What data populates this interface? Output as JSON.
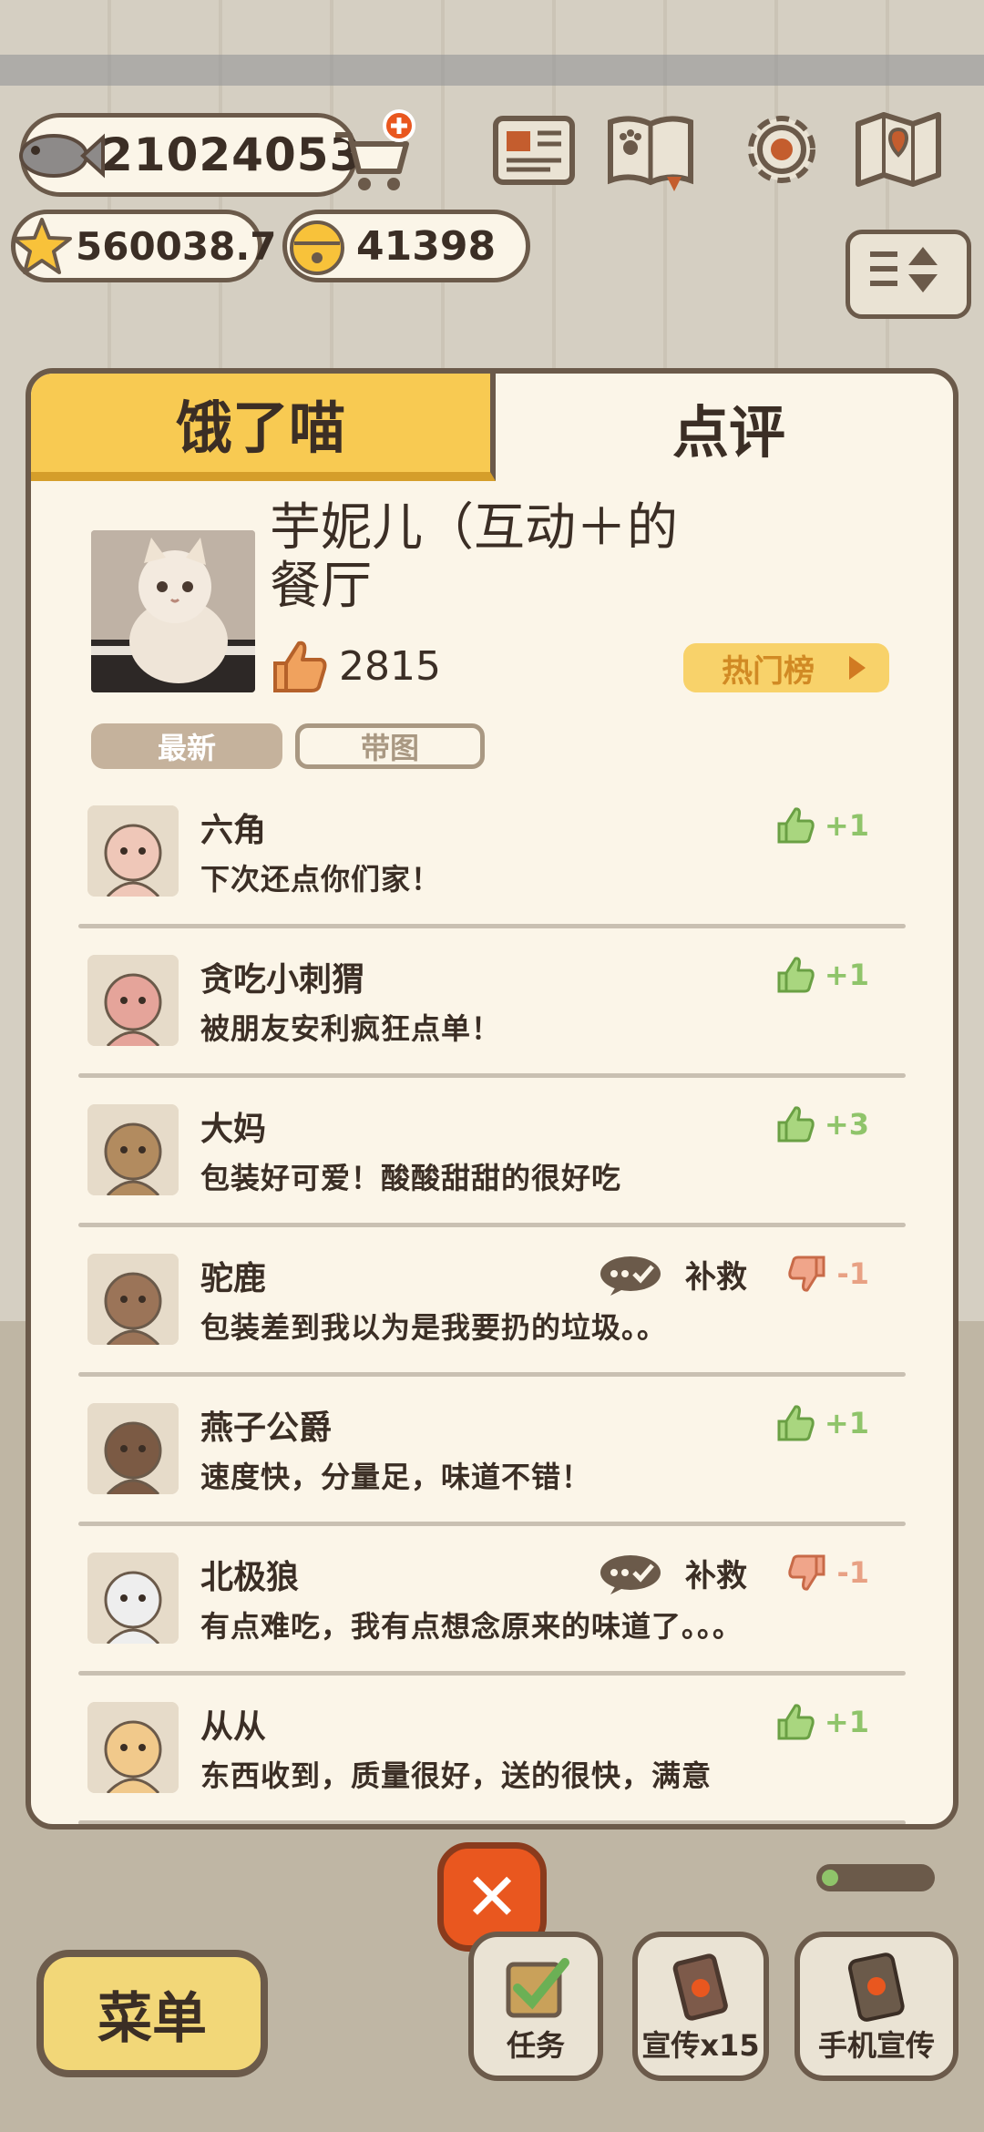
{
  "hud": {
    "fish_value": "21024053",
    "star_value": "560038.7",
    "bell_value": "41398",
    "icons": [
      "fish-icon",
      "shopping-cart-icon",
      "plus-icon",
      "star-icon",
      "bell-icon",
      "newspaper-icon",
      "paw-book-icon",
      "gear-icon",
      "map-icon",
      "sort-icon"
    ]
  },
  "dialog": {
    "tabs": [
      "饿了喵",
      "点评"
    ],
    "active_tab": "点评",
    "shop_name": "芋妮儿（互动＋的餐厅",
    "likes": "2815",
    "hot_list_label": "热门榜",
    "filters": [
      "最新",
      "带图"
    ],
    "active_filter": "最新",
    "reviews": [
      {
        "name": "六角",
        "text": "下次还点你们家！",
        "vote": "+1",
        "type": "up"
      },
      {
        "name": "贪吃小刺猬",
        "text": "被朋友安利疯狂点单！",
        "vote": "+1",
        "type": "up"
      },
      {
        "name": "大妈",
        "text": "包装好可爱！酸酸甜甜的很好吃",
        "vote": "+3",
        "type": "up"
      },
      {
        "name": "驼鹿",
        "text": "包装差到我以为是我要扔的垃圾。。",
        "vote": "-1",
        "type": "down",
        "remedy": "补救"
      },
      {
        "name": "燕子公爵",
        "text": "速度快，分量足，味道不错！",
        "vote": "+1",
        "type": "up"
      },
      {
        "name": "北极狼",
        "text": "有点难吃，我有点想念原来的味道了。。。",
        "vote": "-1",
        "type": "down",
        "remedy": "补救"
      },
      {
        "name": "从从",
        "text": "东西收到，质量很好，送的很快，满意",
        "vote": "+1",
        "type": "up"
      }
    ]
  },
  "bottom": {
    "close_label": "✕",
    "menu_label": "菜单",
    "task_label": "任务",
    "promo_label": "宣传x15",
    "phone_promo_label": "手机宣传",
    "progress": 0.15
  },
  "colors": {
    "panel": "#fbf5e8",
    "border": "#6b5a4a",
    "tab_active": "#f8ca52",
    "like_green": "#8fc46a",
    "dislike_orange": "#e8a184",
    "close_red": "#e9571f"
  }
}
